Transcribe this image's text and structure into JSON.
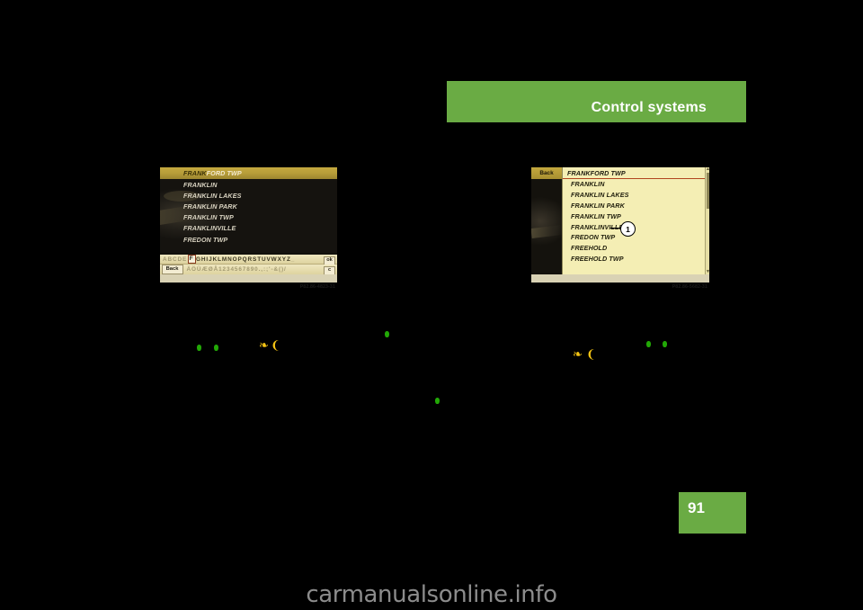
{
  "header": {
    "title": "Control systems",
    "band_color": "#6aab44"
  },
  "page_number": "91",
  "watermark": "carmanualsonline.info",
  "figures": {
    "left": {
      "caption": "P82.86-4823-31",
      "highlight_row": {
        "typed": "FRANK",
        "completion": "FORD TWP"
      },
      "list_items": [
        "FRANKLIN",
        "FRANKLIN LAKES",
        "FRANKLIN PARK",
        "FRANKLIN TWP",
        "FRANKLINVILLE",
        "FREDON TWP"
      ],
      "keyboard": {
        "row1_before": "ABCDE",
        "row1_selected": "F",
        "row1_after_active": "GHIJKLMNOPQRSTUVWXYZ",
        "row1_space": "_",
        "ok_label": "ok",
        "back_label": "Back",
        "row2_accents": "ÄÖÜÆØÅ",
        "row2_digits": "1234567890",
        "row2_symbols": ".,:;'-&()/",
        "clear_label": "c"
      }
    },
    "right": {
      "caption": "P82.86-5682-31",
      "back_label": "Back",
      "selected_row": "FRANKFORD TWP",
      "list_items": [
        "FRANKLIN",
        "FRANKLIN LAKES",
        "FRANKLIN PARK",
        "FRANKLIN TWP",
        "FRANKLINVILLE",
        "FREDON TWP",
        "FREEHOLD",
        "FREEHOLD TWP"
      ],
      "callout_number": "1",
      "scroll_up_glyph": "▲",
      "scroll_down_glyph": "▼"
    }
  },
  "markers": {
    "bullet_glyph": "",
    "brace_open": "❧",
    "brace_close": "❨"
  }
}
